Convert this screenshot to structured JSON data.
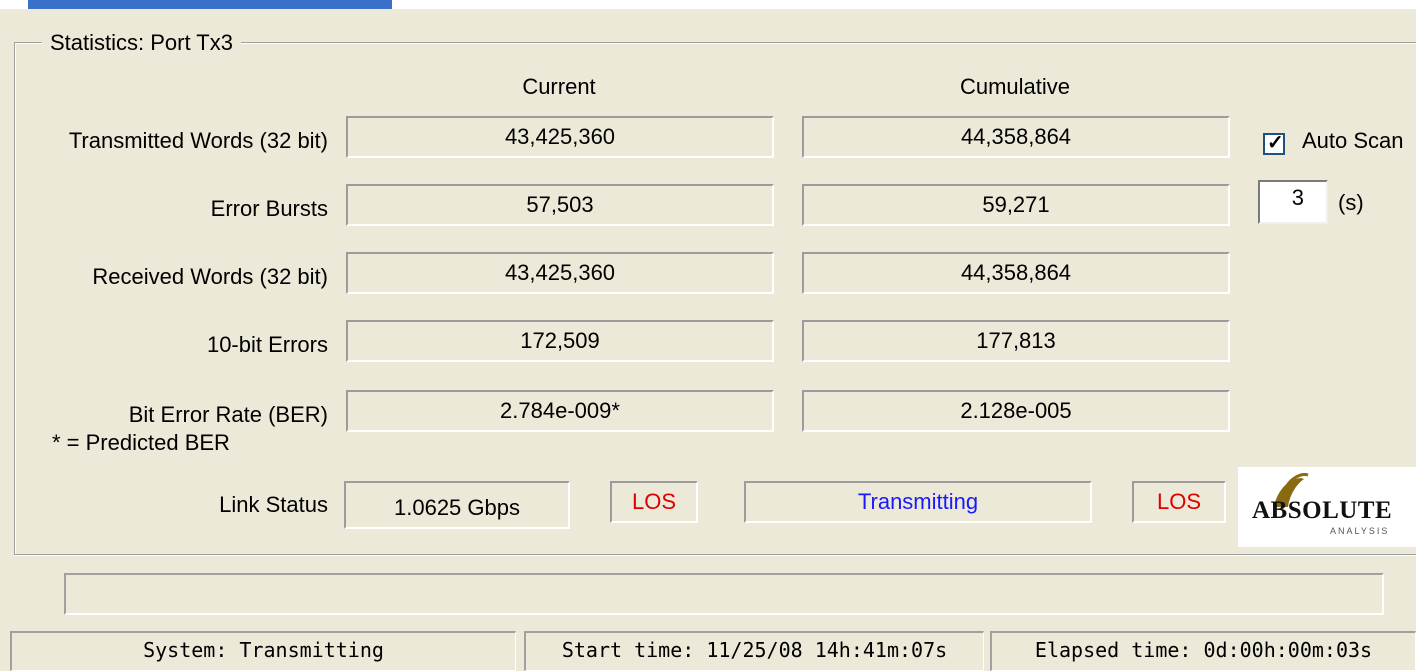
{
  "window": {
    "group_title": "Statistics:  Port Tx3"
  },
  "columns": {
    "current": "Current",
    "cumulative": "Cumulative"
  },
  "rows": [
    {
      "label": "Transmitted Words (32 bit)",
      "current": "43,425,360",
      "cumulative": "44,358,864"
    },
    {
      "label": "Error Bursts",
      "current": "57,503",
      "cumulative": "59,271"
    },
    {
      "label": "Received Words (32 bit)",
      "current": "43,425,360",
      "cumulative": "44,358,864"
    },
    {
      "label": "10-bit Errors",
      "current": "172,509",
      "cumulative": "177,813"
    },
    {
      "label": "Bit Error Rate (BER)",
      "sublabel": "* = Predicted BER",
      "current": "2.784e-009*",
      "cumulative": "2.128e-005"
    }
  ],
  "link_status": {
    "label": "Link Status",
    "speed": "1.0625 Gbps",
    "los_left": "LOS",
    "state": "Transmitting",
    "los_right": "LOS"
  },
  "auto_scan": {
    "label": "Auto Scan",
    "checked": true,
    "interval": "3",
    "unit": "(s)"
  },
  "logo": {
    "text": "ABSOLUTE",
    "sub": "ANALYSIS"
  },
  "statusbar": {
    "system": "System: Transmitting",
    "start": "Start time: 11/25/08  14h:41m:07s",
    "elapsed": "Elapsed time: 0d:00h:00m:03s"
  },
  "colors": {
    "los": "#e00000",
    "state": "#1a1aff",
    "accent": "#3a70c8"
  }
}
